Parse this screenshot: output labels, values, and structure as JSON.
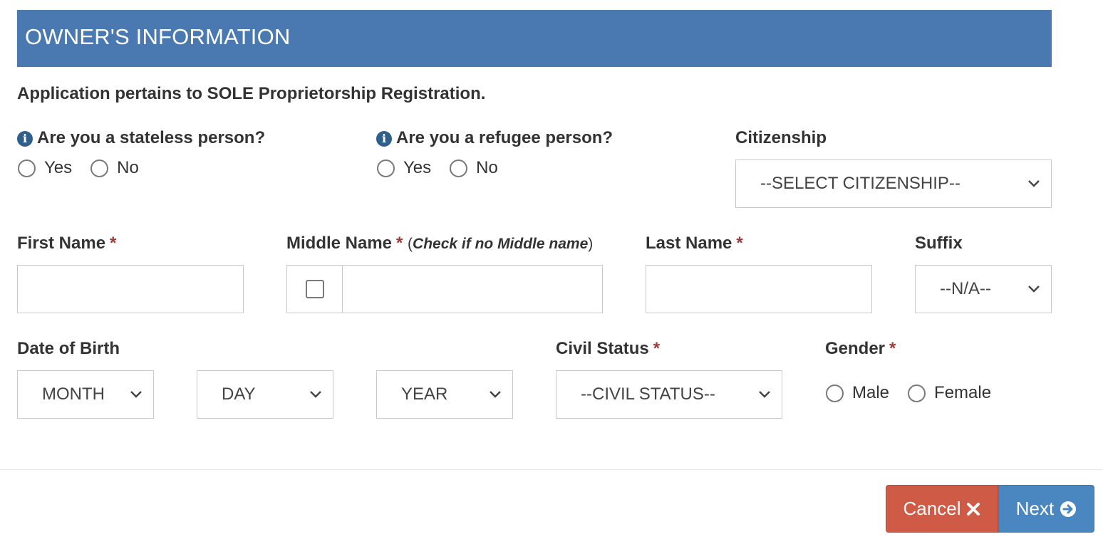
{
  "section": {
    "title": "OWNER'S INFORMATION",
    "notice": "Application pertains to SOLE Proprietorship Registration."
  },
  "stateless": {
    "label": "Are you a stateless person?",
    "options": [
      "Yes",
      "No"
    ]
  },
  "refugee": {
    "label": "Are you a refugee person?",
    "options": [
      "Yes",
      "No"
    ]
  },
  "citizenship": {
    "label": "Citizenship",
    "selected": "--SELECT CITIZENSHIP--"
  },
  "first_name": {
    "label": "First Name",
    "required_mark": "*",
    "value": ""
  },
  "middle_name": {
    "label": "Middle Name",
    "required_mark": "*",
    "note_open": "(",
    "note_text": "Check if no Middle name",
    "note_close": ")",
    "value": ""
  },
  "last_name": {
    "label": "Last Name",
    "required_mark": "*",
    "value": ""
  },
  "suffix": {
    "label": "Suffix",
    "selected": "--N/A--"
  },
  "date_of_birth": {
    "label": "Date of Birth",
    "month": "MONTH",
    "day": "DAY",
    "year": "YEAR"
  },
  "civil_status": {
    "label": "Civil Status",
    "required_mark": "*",
    "selected": "--CIVIL STATUS--"
  },
  "gender": {
    "label": "Gender",
    "required_mark": "*",
    "options": [
      "Male",
      "Female"
    ]
  },
  "buttons": {
    "cancel": "Cancel",
    "next": "Next"
  },
  "colors": {
    "header": "#4a79b1",
    "cancel": "#cf5a45",
    "next": "#4a86c0",
    "required": "#9b3a3a"
  },
  "icons": {
    "info": "info-circle-icon",
    "cancel": "times-icon",
    "next": "arrow-circle-right-icon",
    "select": "chevron-down-icon"
  }
}
